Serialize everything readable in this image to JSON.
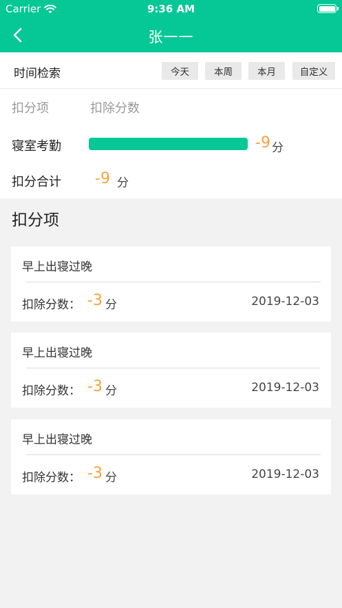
{
  "status_bar": {
    "carrier": "Carrier",
    "time": "9:36 AM"
  },
  "nav": {
    "title": "张一一"
  },
  "filter": {
    "label": "时间检索",
    "options": [
      "今天",
      "本周",
      "本月",
      "自定义"
    ]
  },
  "summary": {
    "col_item": "扣分项",
    "col_points": "扣除分数",
    "category": {
      "label": "寝室考勤",
      "score": "-9",
      "unit": "分",
      "bar_fill": 1.0
    },
    "total": {
      "label": "扣分合计",
      "score": "-9",
      "unit": "分"
    }
  },
  "section_title": "扣分项",
  "records": [
    {
      "title": "早上出寝过晚",
      "deduction_label": "扣除分数：",
      "deduction": "-3",
      "unit": "分",
      "date": "2019-12-03"
    },
    {
      "title": "早上出寝过晚",
      "deduction_label": "扣除分数：",
      "deduction": "-3",
      "unit": "分",
      "date": "2019-12-03"
    },
    {
      "title": "早上出寝过晚",
      "deduction_label": "扣除分数：",
      "deduction": "-3",
      "unit": "分",
      "date": "2019-12-03"
    }
  ],
  "colors": {
    "brand": "#05c896",
    "score": "#f5a23c"
  },
  "icons": {
    "back": "chevron-left-icon",
    "wifi": "wifi-icon",
    "battery": "battery-icon"
  }
}
